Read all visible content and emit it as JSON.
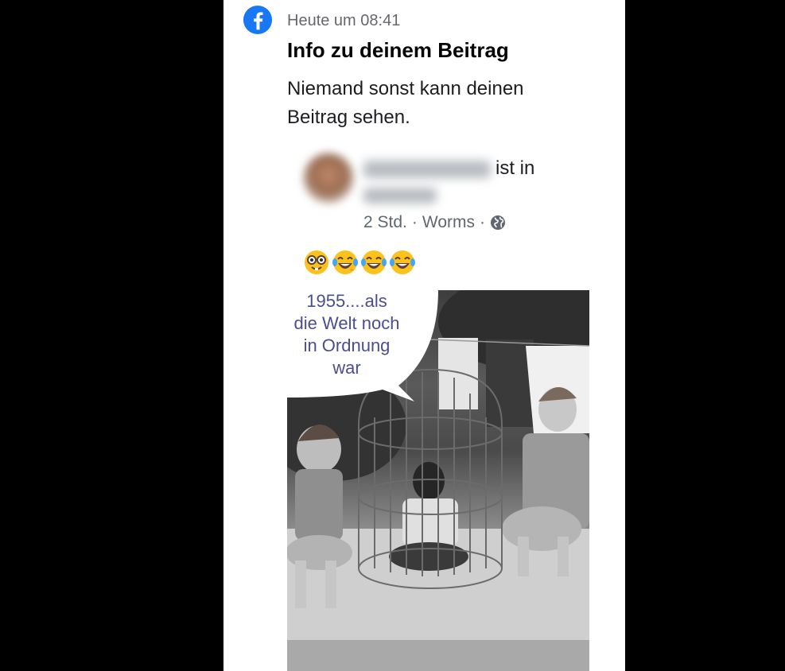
{
  "notification": {
    "timestamp": "Heute um 08:41",
    "title": "Info zu deinem Beitrag",
    "body": "Niemand sonst kann deinen Beitrag sehen."
  },
  "post": {
    "checkin_suffix": "ist in",
    "time": "2 Std.",
    "location": "Worms",
    "separator": "·",
    "emojis": [
      "nerd-face",
      "tears-of-joy",
      "tears-of-joy",
      "tears-of-joy"
    ],
    "image_caption": [
      "1955....als",
      "die Welt noch",
      "in Ordnung",
      "war"
    ]
  },
  "colors": {
    "background": "#000000",
    "panel": "#ffffff",
    "facebook_blue": "#1877f2",
    "caption_text": "#4a4f8c"
  }
}
